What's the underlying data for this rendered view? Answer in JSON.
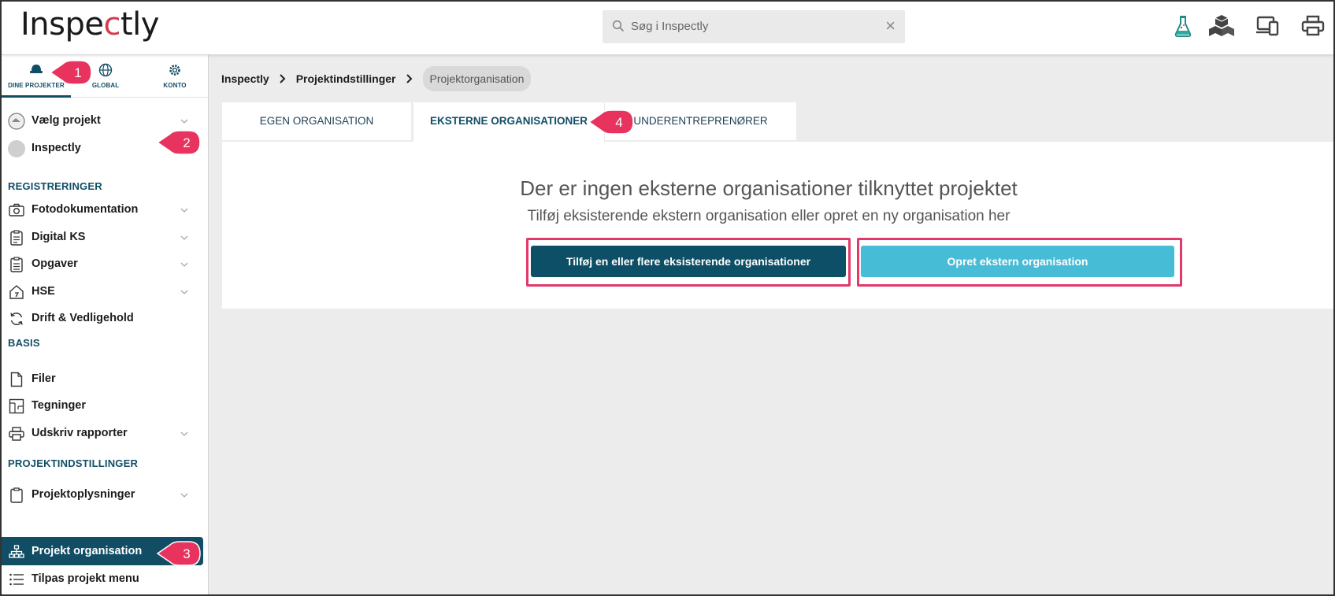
{
  "app": {
    "logo_text_left": "Insp",
    "logo_text_accent": "e",
    "logo_text_c": "c",
    "logo_text_right": "tly"
  },
  "search": {
    "placeholder": "Søg i Inspectly",
    "clear": "×"
  },
  "topbar_icons": [
    "flask-icon",
    "boxes-icon",
    "devices-icon",
    "printer-icon"
  ],
  "sidebar": {
    "tabs": [
      {
        "label": "DINE PROJEKTER",
        "icon": "helmet-icon"
      },
      {
        "label": "GLOBAL",
        "icon": "globe-icon"
      },
      {
        "label": "KONTO",
        "icon": "gear-icon"
      }
    ],
    "project_select": "Vælg projekt",
    "current_project": "Inspectly",
    "sections": {
      "registreringer": "REGISTRERINGER",
      "basis": "BASIS",
      "projektindstillinger": "PROJEKTINDSTILLINGER"
    },
    "items": {
      "fotodokumentation": "Fotodokumentation",
      "digital_ks": "Digital KS",
      "opgaver": "Opgaver",
      "hse": "HSE",
      "drift": "Drift & Vedligehold",
      "filer": "Filer",
      "tegninger": "Tegninger",
      "udskriv": "Udskriv rapporter",
      "projektoplysninger": "Projektoplysninger",
      "projekt_organisation": "Projekt organisation",
      "tilpas": "Tilpas projekt menu"
    }
  },
  "breadcrumb": [
    "Inspectly",
    "Projektindstillinger",
    "Projektorganisation"
  ],
  "tabs": [
    "EGEN ORGANISATION",
    "EKSTERNE ORGANISATIONER",
    "UNDERENTREPRENØRER"
  ],
  "empty_state": {
    "title": "Der er ingen eksterne organisationer tilknyttet projektet",
    "subtitle": "Tilføj eksisterende ekstern organisation eller opret en ny organisation her"
  },
  "buttons": {
    "add_existing": "Tilføj en eller flere eksisterende organisationer",
    "create_external": "Opret ekstern organisation"
  },
  "callouts": [
    "1",
    "2",
    "3",
    "4"
  ],
  "colors": {
    "primary": "#114e66",
    "accent_light": "#47bcd6",
    "highlight": "#e0396a",
    "callout": "#e8335e"
  }
}
